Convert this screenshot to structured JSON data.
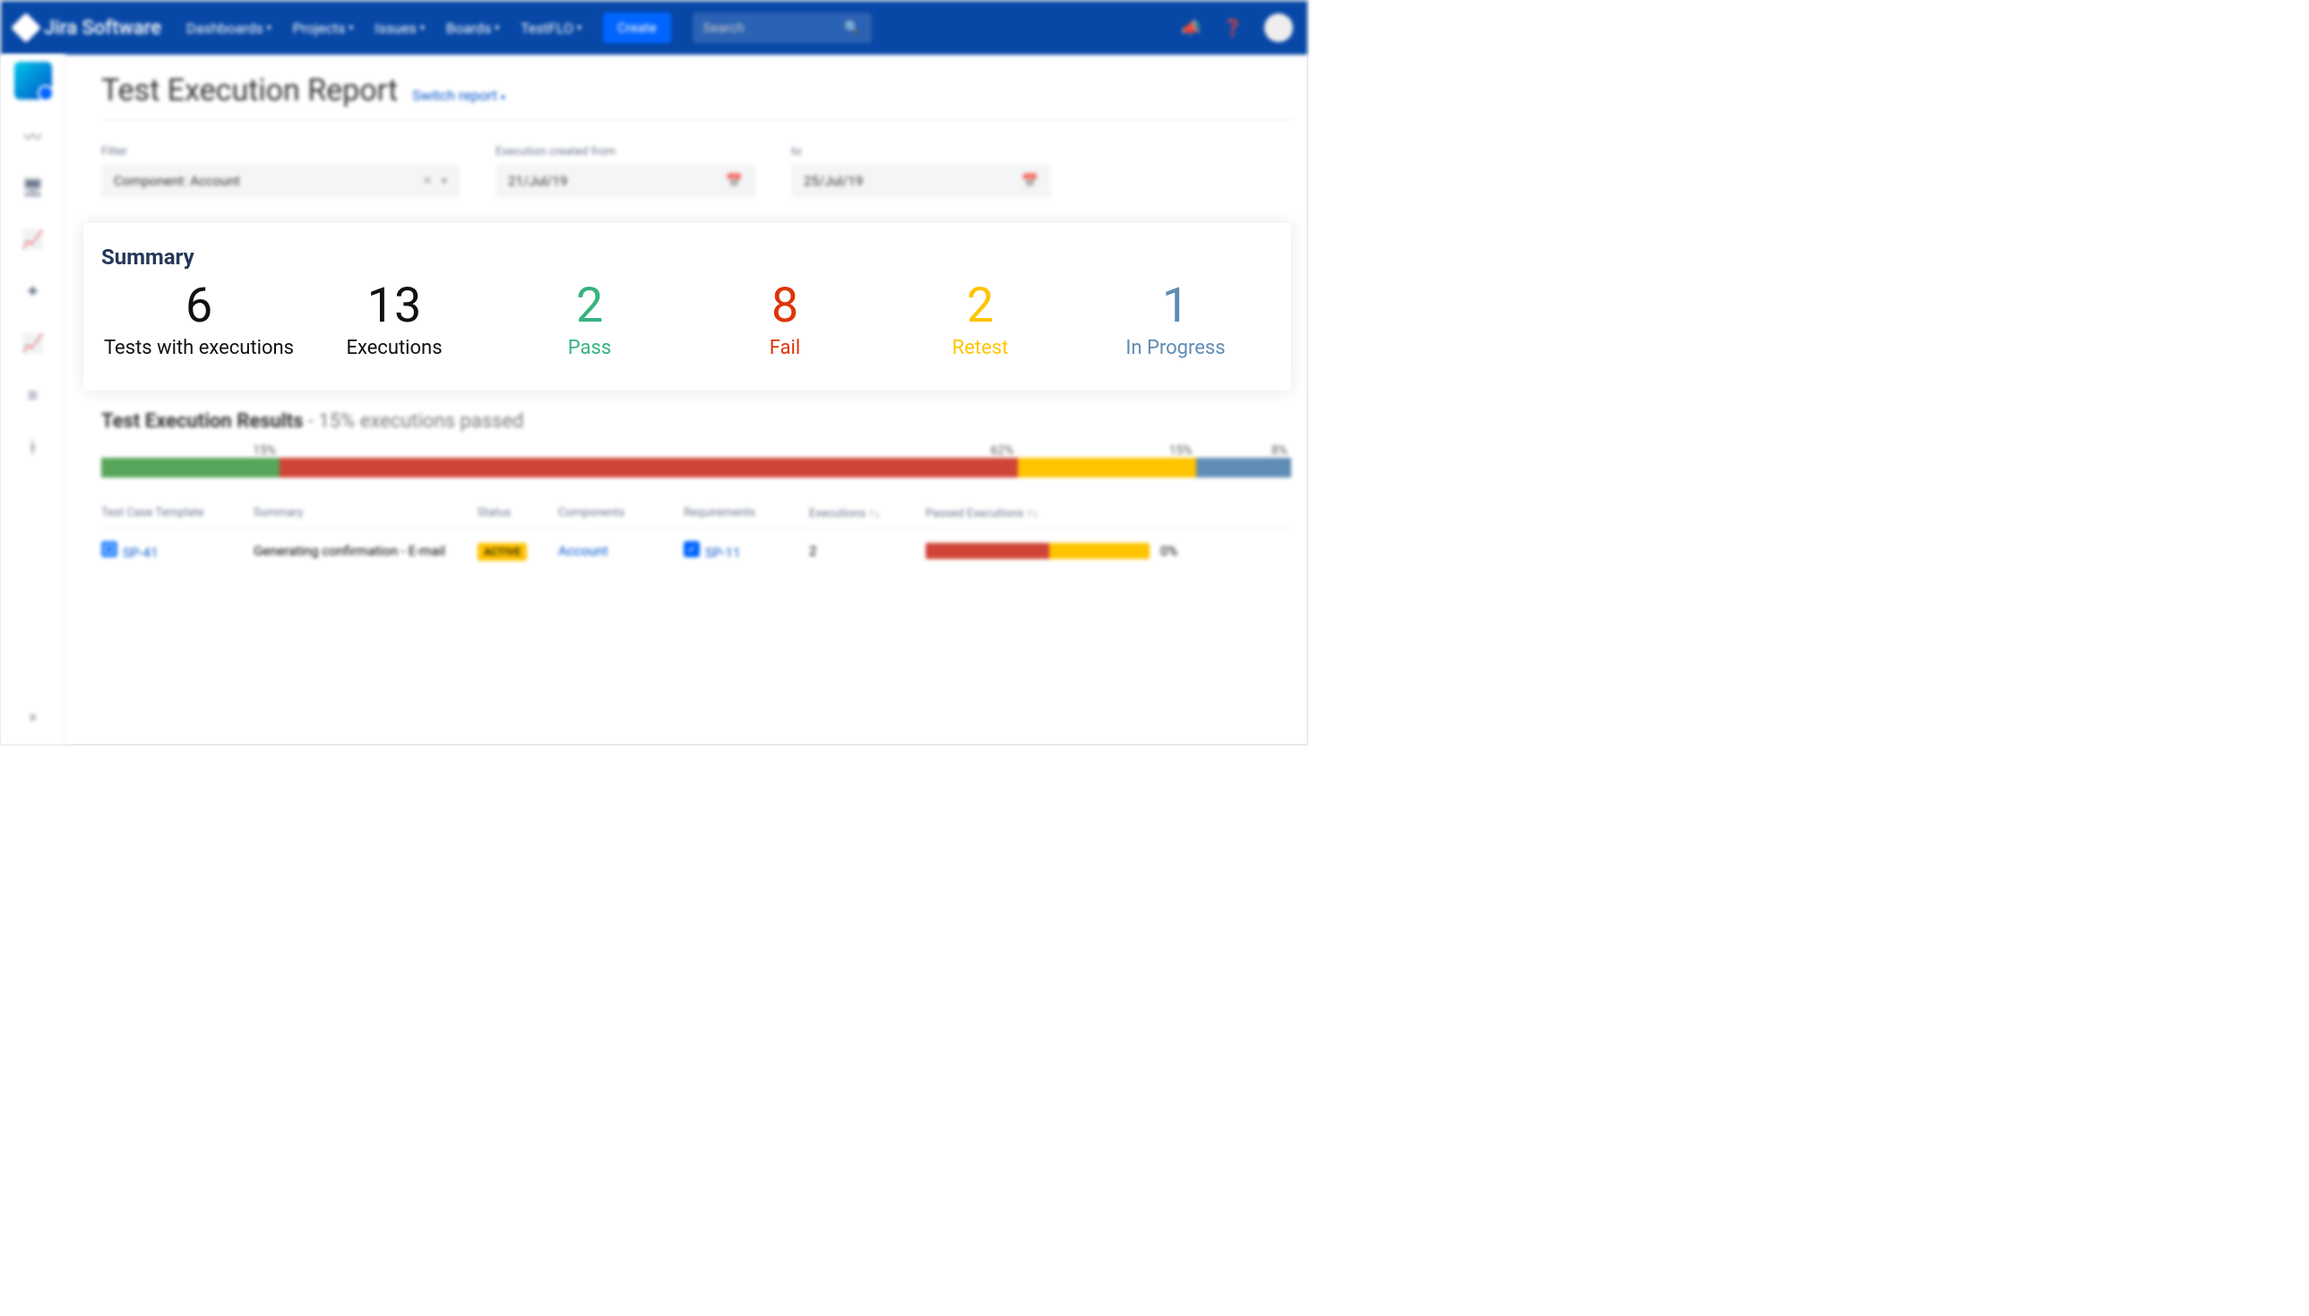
{
  "topnav": {
    "brand": "Jira Software",
    "items": [
      "Dashboards",
      "Projects",
      "Issues",
      "Boards",
      "TestFLO"
    ],
    "create": "Create",
    "searchPlaceholder": "Search"
  },
  "page": {
    "title": "Test Execution Report",
    "switchReport": "Switch report"
  },
  "filters": {
    "filterLabel": "Filter",
    "filterValue": "Component: Account",
    "fromLabel": "Execution created from",
    "fromValue": "21/Jul/19",
    "toLabel": "to",
    "toValue": "25/Jul/19"
  },
  "summary": {
    "title": "Summary",
    "metrics": [
      {
        "value": "6",
        "label": "Tests with executions",
        "colorClass": "c-black"
      },
      {
        "value": "13",
        "label": "Executions",
        "colorClass": "c-black"
      },
      {
        "value": "2",
        "label": "Pass",
        "colorClass": "c-green"
      },
      {
        "value": "8",
        "label": "Fail",
        "colorClass": "c-red"
      },
      {
        "value": "2",
        "label": "Retest",
        "colorClass": "c-yellow"
      },
      {
        "value": "1",
        "label": "In Progress",
        "colorClass": "c-blue"
      }
    ]
  },
  "results": {
    "titlePrefix": "Test Execution Results",
    "titleSuffix": " - 15% executions passed",
    "segments": [
      {
        "label": "15%",
        "width": 15,
        "class": "seg-green"
      },
      {
        "label": "62%",
        "width": 62,
        "class": "seg-red"
      },
      {
        "label": "15%",
        "width": 15,
        "class": "seg-yellow"
      },
      {
        "label": "8%",
        "width": 8,
        "class": "seg-blue"
      }
    ]
  },
  "table": {
    "headers": {
      "tct": "Test Case Template",
      "summary": "Summary",
      "status": "Status",
      "components": "Components",
      "requirements": "Requirements",
      "executions": "Executions ↑↓",
      "passed": "Passed Executions ↑↓"
    },
    "row": {
      "tct": "SP-41",
      "summary": "Generating confirmation - E-mail",
      "status": "ACTIVE",
      "components": "Account",
      "requirements": "SP-11",
      "executions": "2",
      "passedPct": "0%",
      "passedBar": [
        {
          "class": "seg-red",
          "width": 55
        },
        {
          "class": "seg-yellow",
          "width": 45
        }
      ]
    }
  }
}
